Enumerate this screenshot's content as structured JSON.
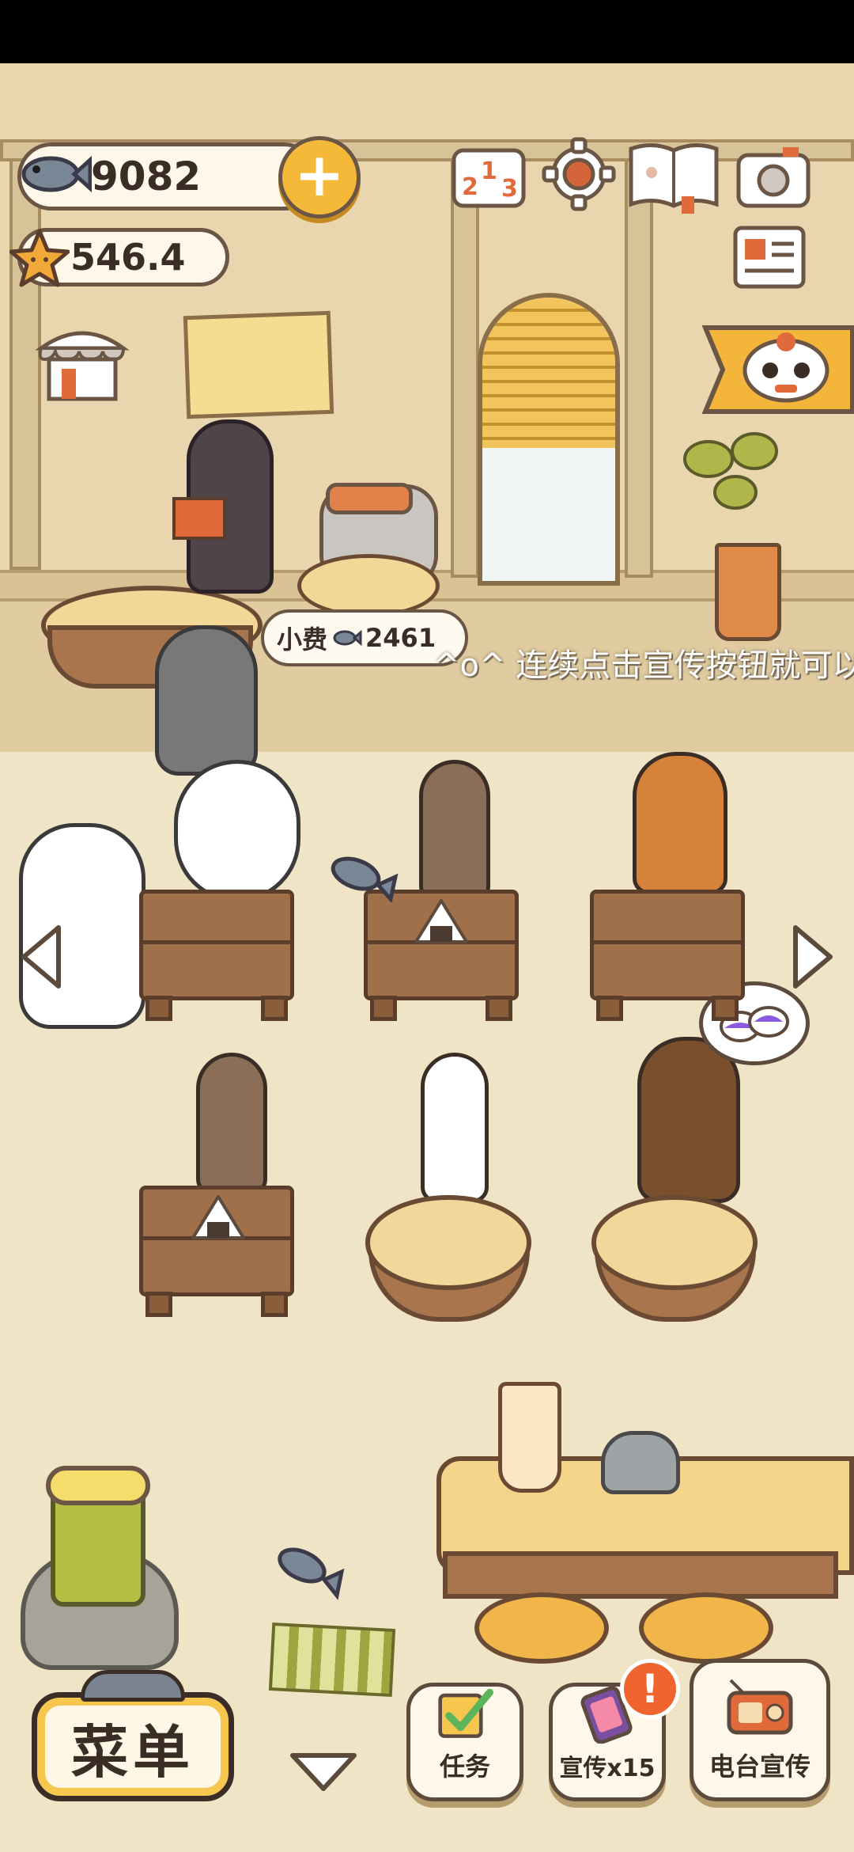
{
  "hud": {
    "fish_count": "9082",
    "star_rating": "546.4"
  },
  "tip_bubble": {
    "label": "小费",
    "amount": "2461"
  },
  "marquee": {
    "text": "^o^ 连续点击宣传按钮就可以"
  },
  "bottom_bar": {
    "menu_label": "菜单",
    "tasks_label": "任务",
    "promote_label": "宣传x15",
    "promote_badge": "!",
    "radio_label": "电台宣传"
  },
  "icons": [
    "fish-icon",
    "plus-icon",
    "star-icon",
    "ranking-icon",
    "settings-gear-icon",
    "guestbook-icon",
    "camera-icon",
    "newspaper-icon",
    "shop-icon",
    "lion-dance-event-icon",
    "left-arrow-icon",
    "right-arrow-icon",
    "chevron-down-icon",
    "task-checkbox-icon",
    "phone-icon",
    "radio-icon"
  ],
  "colors": {
    "accent_yellow": "#f6c64e",
    "badge_orange": "#f0642e",
    "outline": "#3a2d26"
  }
}
